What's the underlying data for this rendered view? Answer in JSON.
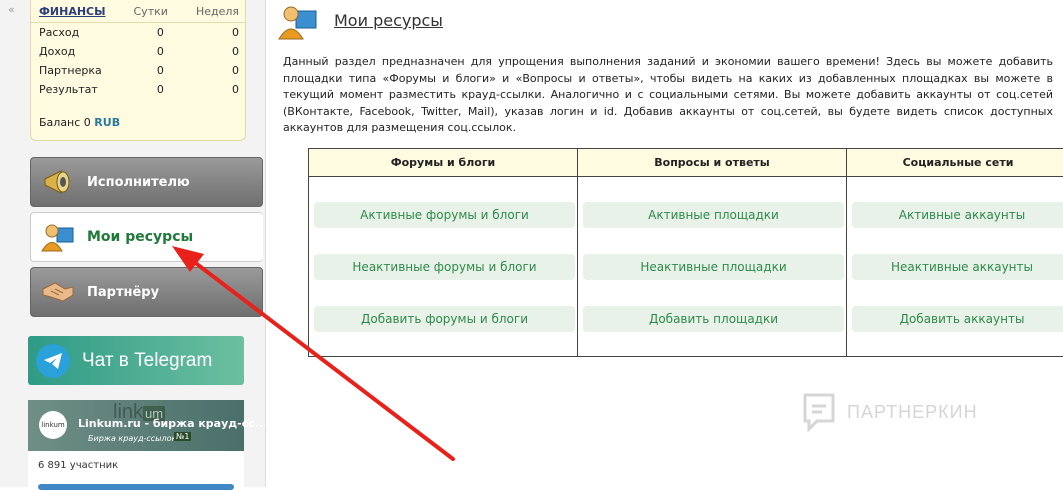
{
  "sidebar": {
    "collapse_label": "«",
    "finance": {
      "title": "ФИНАНСЫ",
      "col_day": "Сутки",
      "col_week": "Неделя",
      "rows": [
        {
          "label": "Расход",
          "day": "0",
          "week": "0"
        },
        {
          "label": "Доход",
          "day": "0",
          "week": "0"
        },
        {
          "label": "Партнерка",
          "day": "0",
          "week": "0"
        },
        {
          "label": "Результат",
          "day": "0",
          "week": "0"
        }
      ],
      "balance_label": "Баланс 0",
      "currency": "RUB"
    },
    "menu": [
      {
        "label": "Исполнителю",
        "icon": "megaphone-icon"
      },
      {
        "label": "Мои ресурсы",
        "icon": "user-monitor-icon"
      },
      {
        "label": "Партнёру",
        "icon": "handshake-icon"
      }
    ],
    "telegram": {
      "label": "Чат в Telegram"
    },
    "channel": {
      "logo_text": "linkum",
      "banner_word": "link",
      "banner_badge": "um",
      "title": "Linkum.ru - биржа крауд-сс...",
      "subtitle": "Биржа крауд-ссылок",
      "badge": "№1",
      "members": "6 891 участник"
    }
  },
  "main": {
    "title": "Мои ресурсы",
    "intro": "Данный раздел предназначен для упрощения выполнения заданий и экономии вашего времени! Здесь вы можете добавить площадки типа «Форумы и блоги» и «Вопросы и ответы», чтобы видеть на каких из добавленных площадках вы можете в текущий момент разместить крауд-ссылки. Аналогично и с социальными сетями. Вы можете добавить аккаунты от соц.сетей (ВКонтакте, Facebook, Twitter, Mail), указав логин и id. Добавив аккаунты от соц.сетей, вы будете видеть список доступных аккаунтов для размещения соц.ссылок.",
    "columns": [
      {
        "header": "Форумы и блоги",
        "buttons": [
          "Активные форумы и блоги",
          "Неактивные форумы и блоги",
          "Добавить форумы и блоги"
        ]
      },
      {
        "header": "Вопросы и ответы",
        "buttons": [
          "Активные площадки",
          "Неактивные площадки",
          "Добавить площадки"
        ]
      },
      {
        "header": "Социальные сети",
        "buttons": [
          "Активные аккаунты",
          "Неактивные аккаунты",
          "Добавить аккаунты"
        ]
      }
    ]
  },
  "watermark": {
    "text": "ПАРТНЕРКИН"
  },
  "colors": {
    "accent_green": "#2e8a4a",
    "button_bg": "#e8f2e8",
    "header_bg": "#fffbe0",
    "arrow": "#e8221b"
  }
}
